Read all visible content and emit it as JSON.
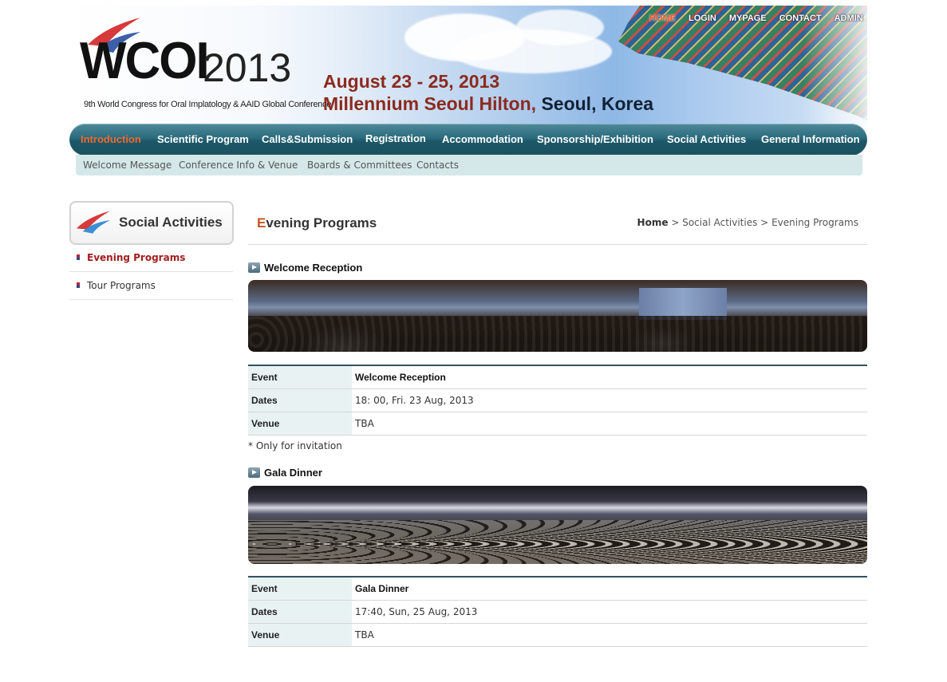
{
  "header": {
    "logo_main": "WCOI",
    "logo_year": "2013",
    "logo_sub": "9th World Congress for Oral Implatology & AAID Global Conference",
    "date": "August 23 - 25, 2013",
    "venue": "Millennium Seoul Hilton,",
    "city": "Seoul, Korea",
    "util_nav": [
      "HOME",
      "LOGIN",
      "MYPAGE",
      "CONTACT",
      "ADMIN"
    ]
  },
  "main_nav": [
    "Introduction",
    "Scientific Program",
    "Calls&Submission",
    "Registration",
    "Accommodation",
    "Sponsorship/Exhibition",
    "Social Activities",
    "General Information"
  ],
  "sub_nav": [
    "Welcome Message",
    "Conference Info & Venue",
    "Boards & Committees",
    "Contacts"
  ],
  "sidebar": {
    "title": "Social Activities",
    "items": [
      "Evening Programs",
      "Tour Programs"
    ]
  },
  "page": {
    "title_first": "E",
    "title_rest": "vening Programs",
    "breadcrumb": {
      "home": "Home",
      "sep": ">",
      "section": "Social Activities",
      "current": "Evening Programs"
    }
  },
  "sections": [
    {
      "heading": "Welcome Reception",
      "rows": [
        {
          "key": "Event",
          "value": "Welcome Reception"
        },
        {
          "key": "Dates",
          "value": "18: 00, Fri. 23 Aug, 2013"
        },
        {
          "key": "Venue",
          "value": "TBA"
        }
      ],
      "note": "* Only for invitation"
    },
    {
      "heading": "Gala Dinner",
      "rows": [
        {
          "key": "Event",
          "value": "Gala Dinner"
        },
        {
          "key": "Dates",
          "value": "17:40, Sun, 25 Aug, 2013"
        },
        {
          "key": "Venue",
          "value": "TBA"
        }
      ]
    }
  ],
  "colors": {
    "accent_orange": "#ef6a2e",
    "nav_teal": "#2a6b7d",
    "brand_red": "#8c2a1f",
    "subnav_bg": "#d4e8ea"
  }
}
